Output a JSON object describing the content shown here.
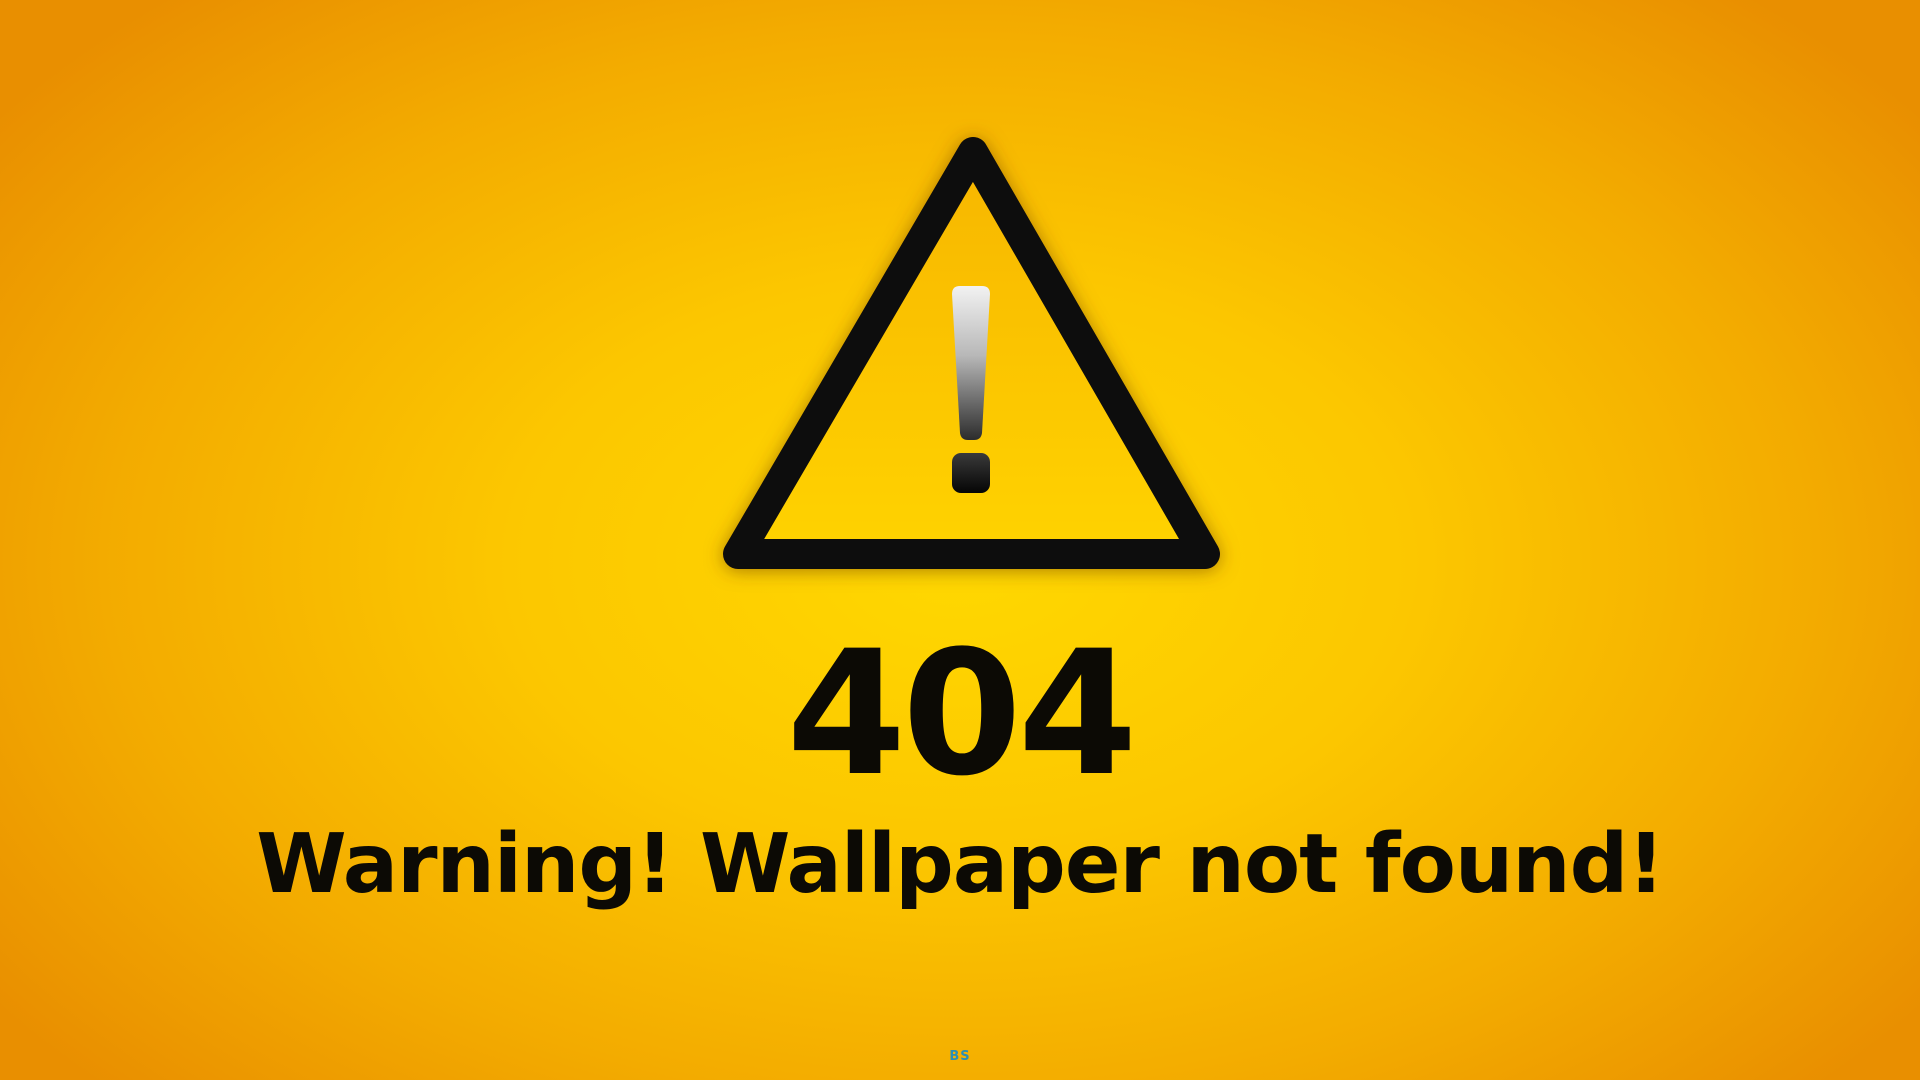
{
  "warning_sign": {
    "icon": "warning-triangle-exclamation-icon",
    "stroke_color": "#0a0a0a",
    "fill_color": "#ffc800"
  },
  "error_code": "404",
  "message": "Warning! Wallpaper not found!",
  "watermark": "BS",
  "colors": {
    "background_center": "#ffd800",
    "background_edge": "#e98f00",
    "text": "#0c0a05",
    "watermark": "#2a8fb5"
  }
}
